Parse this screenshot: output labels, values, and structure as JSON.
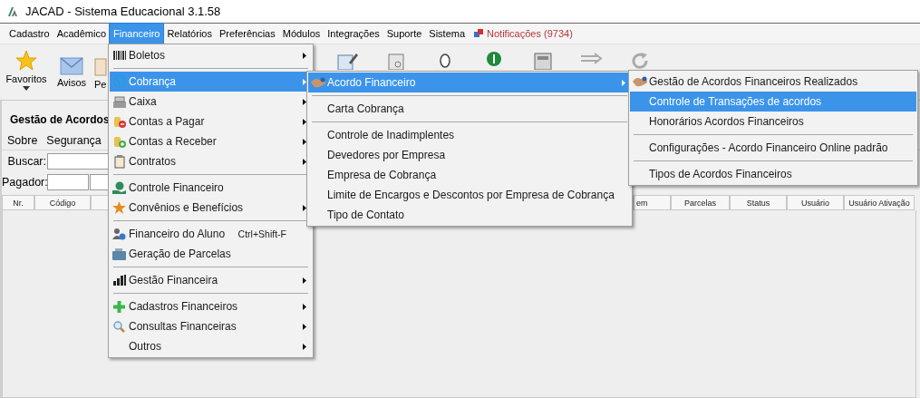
{
  "window": {
    "title": "JACAD - Sistema Educacional 3.1.58"
  },
  "menu_bar": [
    {
      "label": "Cadastro",
      "selected": false
    },
    {
      "label": "Acadêmico",
      "selected": false
    },
    {
      "label": "Financeiro",
      "selected": true
    },
    {
      "label": "Relatórios",
      "selected": false
    },
    {
      "label": "Preferências",
      "selected": false
    },
    {
      "label": "Módulos",
      "selected": false
    },
    {
      "label": "Integrações",
      "selected": false
    },
    {
      "label": "Suporte",
      "selected": false
    },
    {
      "label": "Sistema",
      "selected": false
    }
  ],
  "notifications": {
    "label": "Notificações (9734)"
  },
  "toolbar": [
    {
      "label": "Favoritos",
      "dropdown": true
    },
    {
      "label": "Avisos",
      "dropdown": false
    },
    {
      "label": "Pe",
      "dropdown": false
    }
  ],
  "inner_window": {
    "title": "Gestão de Acordos",
    "menu": [
      "Sobre",
      "Segurança"
    ],
    "filters": [
      {
        "label": "Buscar:"
      },
      {
        "label": "Pagador:"
      }
    ],
    "columns": [
      "Nr.",
      "Código",
      "",
      "em",
      "Parcelas",
      "Status",
      "Usuário",
      "Usuário Ativação"
    ]
  },
  "menus": [
    {
      "items": [
        {
          "kind": "item",
          "label": "Boletos",
          "submenu": true,
          "selected": false
        },
        {
          "kind": "separator"
        },
        {
          "kind": "item",
          "label": "Cobrança",
          "submenu": true,
          "selected": true
        },
        {
          "kind": "item",
          "label": "Caixa",
          "submenu": true,
          "selected": false
        },
        {
          "kind": "item",
          "label": "Contas a Pagar",
          "submenu": true,
          "selected": false
        },
        {
          "kind": "item",
          "label": "Contas a Receber",
          "submenu": true,
          "selected": false
        },
        {
          "kind": "item",
          "label": "Contratos",
          "submenu": true,
          "selected": false
        },
        {
          "kind": "separator"
        },
        {
          "kind": "item",
          "label": "Controle Financeiro",
          "submenu": false,
          "selected": false
        },
        {
          "kind": "item",
          "label": "Convênios e Benefícios",
          "submenu": true,
          "selected": false
        },
        {
          "kind": "separator"
        },
        {
          "kind": "item",
          "label": "Financeiro do Aluno",
          "shortcut": "Ctrl+Shift-F",
          "submenu": false,
          "selected": false
        },
        {
          "kind": "item",
          "label": "Geração de Parcelas",
          "submenu": false,
          "selected": false
        },
        {
          "kind": "separator"
        },
        {
          "kind": "item",
          "label": "Gestão Financeira",
          "submenu": true,
          "selected": false
        },
        {
          "kind": "separator"
        },
        {
          "kind": "item",
          "label": "Cadastros Financeiros",
          "submenu": true,
          "selected": false
        },
        {
          "kind": "item",
          "label": "Consultas Financeiras",
          "submenu": true,
          "selected": false
        },
        {
          "kind": "item",
          "label": "Outros",
          "submenu": true,
          "selected": false
        }
      ]
    },
    {
      "items": [
        {
          "kind": "item",
          "label": "Acordo Financeiro",
          "submenu": true,
          "selected": true
        },
        {
          "kind": "separator"
        },
        {
          "kind": "item",
          "label": "Carta Cobrança",
          "submenu": false,
          "selected": false
        },
        {
          "kind": "separator"
        },
        {
          "kind": "item",
          "label": "Controle de Inadimplentes",
          "submenu": false,
          "selected": false
        },
        {
          "kind": "item",
          "label": "Devedores por Empresa",
          "submenu": false,
          "selected": false
        },
        {
          "kind": "item",
          "label": "Empresa de Cobrança",
          "submenu": false,
          "selected": false
        },
        {
          "kind": "item",
          "label": "Limite de Encargos e Descontos por Empresa de Cobrança",
          "submenu": false,
          "selected": false
        },
        {
          "kind": "item",
          "label": "Tipo de Contato",
          "submenu": false,
          "selected": false
        }
      ]
    },
    {
      "items": [
        {
          "kind": "item",
          "label": "Gestão de Acordos Financeiros Realizados",
          "submenu": false,
          "selected": false
        },
        {
          "kind": "item",
          "label": "Controle de Transações de acordos",
          "submenu": false,
          "selected": true
        },
        {
          "kind": "item",
          "label": "Honorários Acordos Financeiros",
          "submenu": false,
          "selected": false
        },
        {
          "kind": "separator"
        },
        {
          "kind": "item",
          "label": "Configurações - Acordo Financeiro Online padrão",
          "submenu": false,
          "selected": false
        },
        {
          "kind": "separator"
        },
        {
          "kind": "item",
          "label": "Tipos de Acordos Financeiros",
          "submenu": false,
          "selected": false
        }
      ]
    }
  ]
}
